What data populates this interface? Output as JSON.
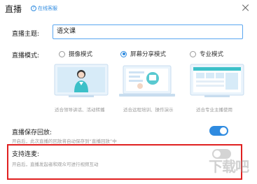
{
  "window": {
    "title": "直播",
    "help_label": "在线客服"
  },
  "form": {
    "topic_label": "直播主题:",
    "topic_value": "语文课",
    "mode_label": "直播模式:",
    "modes": [
      {
        "label": "摄像模式",
        "selected": false,
        "caption": "适合领导讲话、活动转播"
      },
      {
        "label": "屏幕分享模式",
        "selected": true,
        "caption": "适合远程培训、操作演示"
      },
      {
        "label": "专业模式",
        "selected": false,
        "caption": "适合专业主播使用"
      }
    ]
  },
  "settings": {
    "save_replay": {
      "label": "直播保存回放:",
      "desc": "开启后，此次直播的回放将自动保存到“直播回放”中",
      "enabled": true
    },
    "co_host": {
      "label": "支持连麦:",
      "desc": "开启后，直播发起者和观众可进行视频互动",
      "enabled": false
    }
  },
  "colors": {
    "accent": "#2f8be0",
    "highlight_border": "#e02020",
    "toggle_off": "#d4d4d4"
  }
}
